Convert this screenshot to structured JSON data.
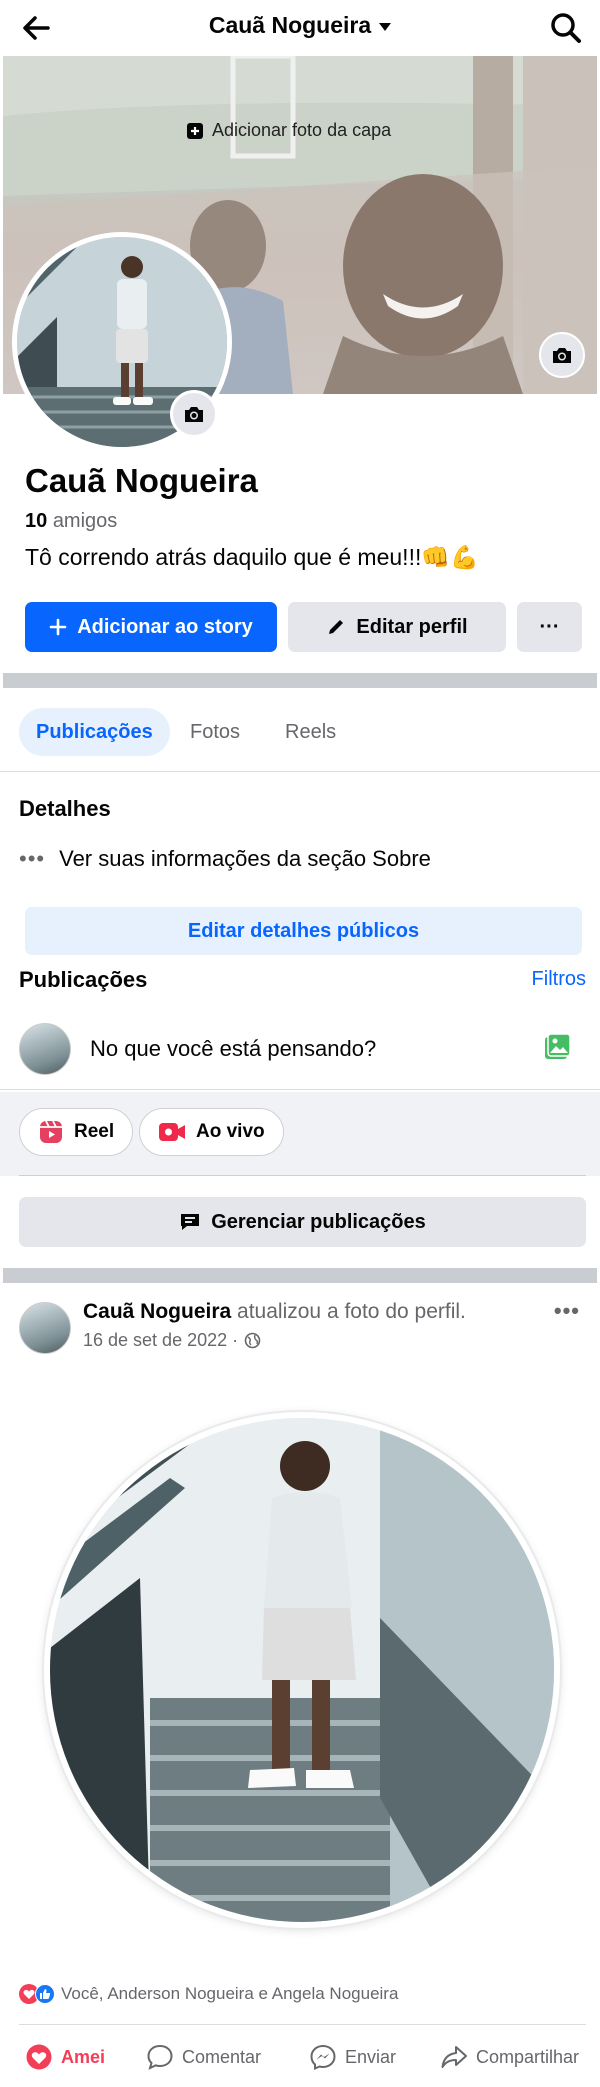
{
  "topbar": {
    "title": "Cauã Nogueira"
  },
  "cover": {
    "add_cover_label": "Adicionar foto da capa"
  },
  "profile": {
    "name": "Cauã Nogueira",
    "friends_count": "10",
    "friends_label": "amigos",
    "bio": "Tô correndo atrás daquilo que é meu!!!👊💪"
  },
  "actions": {
    "add_story": "Adicionar ao story",
    "edit_profile": "Editar perfil",
    "more": "···"
  },
  "tabs": [
    {
      "label": "Publicações",
      "active": true
    },
    {
      "label": "Fotos",
      "active": false
    },
    {
      "label": "Reels",
      "active": false
    }
  ],
  "details": {
    "title": "Detalhes",
    "about_link": "Ver suas informações da seção Sobre",
    "edit_public": "Editar detalhes públicos"
  },
  "publications": {
    "title": "Publicações",
    "filters": "Filtros",
    "composer_prompt": "No que você está pensando?",
    "chips": [
      "Reel",
      "Ao vivo"
    ],
    "manage": "Gerenciar publicações"
  },
  "post": {
    "author": "Cauã Nogueira",
    "action": "atualizou a foto do perfil.",
    "date": "16 de set de 2022 ·",
    "reactions_text": "Você, Anderson Nogueira e Angela Nogueira",
    "buttons": [
      "Amei",
      "Comentar",
      "Enviar",
      "Compartilhar"
    ]
  },
  "colors": {
    "primary": "#0866ff",
    "love": "#f33e58"
  }
}
